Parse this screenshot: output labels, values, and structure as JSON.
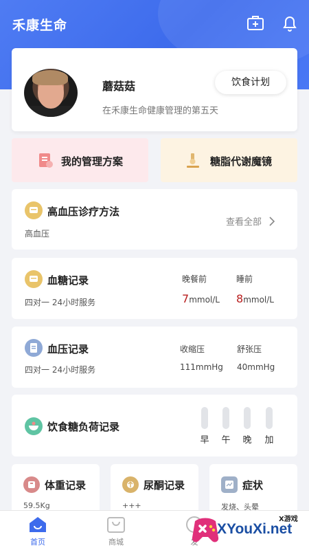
{
  "app": {
    "title": "禾康生命"
  },
  "header": {
    "icons": [
      "medical-kit-icon",
      "bell-icon"
    ]
  },
  "profile": {
    "name": "蘑菇菇",
    "subtitle": "在禾康生命健康管理的第五天",
    "diet_plan_label": "饮食计划"
  },
  "quick_actions": [
    {
      "label": "我的管理方案",
      "icon": "clipboard-icon",
      "color": "#fde9ec"
    },
    {
      "label": "糖脂代谢魔镜",
      "icon": "microscope-icon",
      "color": "#fdf3e2"
    }
  ],
  "hypertension": {
    "title": "高血压诊疗方法",
    "subtitle": "高血压",
    "view_all": "查看全部"
  },
  "blood_sugar": {
    "title": "血糖记录",
    "subtitle": "四对一 24小时服务",
    "columns": [
      {
        "label": "晚餐前",
        "value": "7",
        "unit": "mmol/L"
      },
      {
        "label": "睡前",
        "value": "8",
        "unit": "mmol/L"
      }
    ]
  },
  "blood_pressure": {
    "title": "血压记录",
    "subtitle": "四对一 24小时服务",
    "columns": [
      {
        "label": "收缩压",
        "value": "111mmHg"
      },
      {
        "label": "舒张压",
        "value": "40mmHg"
      }
    ]
  },
  "diet_load": {
    "title": "饮食糖负荷记录",
    "meals": [
      "早",
      "午",
      "晚",
      "加"
    ]
  },
  "small_cards": [
    {
      "title": "体重记录",
      "value": "59.5Kg",
      "icon": "scale-icon",
      "color": "#d88a8a"
    },
    {
      "title": "尿酮记录",
      "value": "+++",
      "icon": "drop-icon",
      "color": "#d9b36a"
    },
    {
      "title": "症状",
      "value": "发烧、头晕",
      "icon": "chart-icon",
      "color": "#9fb0c8"
    }
  ],
  "tabs": [
    {
      "label": "首页",
      "active": true
    },
    {
      "label": "商城",
      "active": false
    },
    {
      "label": "发",
      "active": false
    }
  ],
  "watermark": {
    "brand": "XYouXi.net",
    "tag": "X游戏"
  },
  "colors": {
    "primary": "#3d6bec",
    "accent_red": "#b81c1c"
  }
}
